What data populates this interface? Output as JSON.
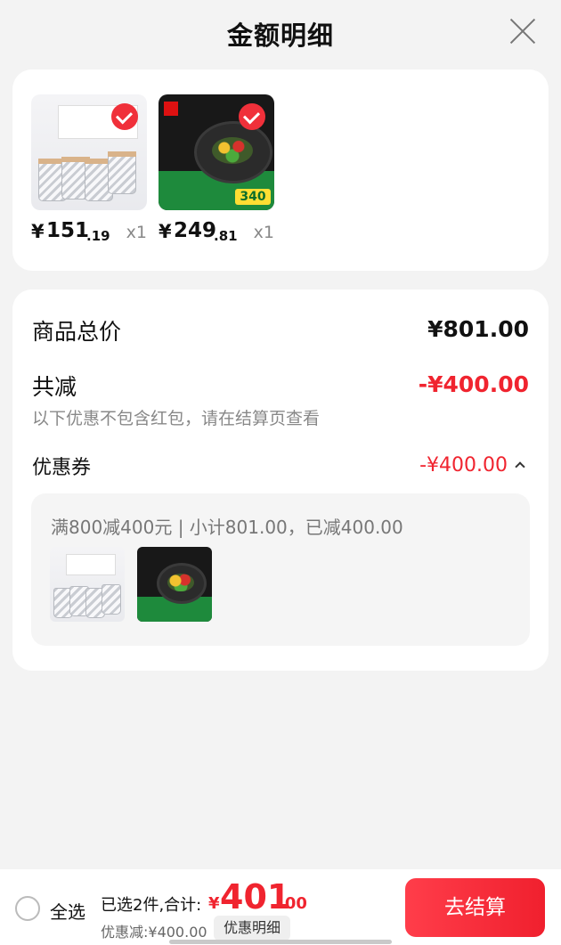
{
  "header": {
    "title": "金额明细"
  },
  "products": [
    {
      "price_yen": "¥",
      "price_int": "151",
      "price_dec": ".19",
      "qty": "x1",
      "image": "glass-set"
    },
    {
      "price_yen": "¥",
      "price_int": "249",
      "price_dec": ".81",
      "qty": "x1",
      "image": "wok-pan",
      "image_tag": "340"
    }
  ],
  "summary": {
    "total_label": "商品总价",
    "total_value": "¥801.00",
    "reduce_label": "共减",
    "reduce_value": "-¥400.00",
    "note": "以下优惠不包含红包，请在结算页查看",
    "coupon_label": "优惠券",
    "coupon_value": "-¥400.00",
    "coupon_desc": "满800减400元 | 小计801.00，已减400.00"
  },
  "bottom": {
    "select_all": "全选",
    "summary_text": "已选2件,合计:",
    "total_yen": "¥",
    "total_int": "401",
    "total_dec": ".00",
    "discount_text": "优惠减:¥400.00",
    "detail_button": "优惠明细",
    "checkout_button": "去结算"
  },
  "colors": {
    "accent": "#f0242f",
    "background": "#f3f3f3"
  }
}
